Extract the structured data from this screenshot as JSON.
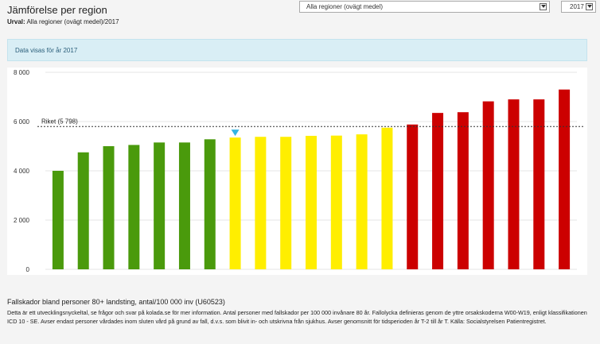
{
  "header": {
    "title": "Jämförelse per region",
    "urval_label": "Urval:",
    "urval_value": "Alla regioner (ovägt medel)/2017"
  },
  "controls": {
    "region_select": "Alla regioner (ovägt medel)",
    "year_select": "2017"
  },
  "info_banner": "Data visas för år 2017",
  "chart_data": {
    "type": "bar",
    "categories": [],
    "values": [
      4000,
      4750,
      5000,
      5050,
      5150,
      5150,
      5280,
      5350,
      5380,
      5380,
      5420,
      5430,
      5480,
      5750,
      5880,
      6350,
      6380,
      6820,
      6900,
      6900,
      7300
    ],
    "bar_colors": [
      "#4a9a0c",
      "#4a9a0c",
      "#4a9a0c",
      "#4a9a0c",
      "#4a9a0c",
      "#4a9a0c",
      "#4a9a0c",
      "#ffee00",
      "#ffee00",
      "#ffee00",
      "#ffee00",
      "#ffee00",
      "#ffee00",
      "#ffee00",
      "#cc0000",
      "#cc0000",
      "#cc0000",
      "#cc0000",
      "#cc0000",
      "#cc0000",
      "#cc0000"
    ],
    "highlight_index": 7,
    "highlight_color": "#33b5e5",
    "y_ticks": [
      0,
      2000,
      4000,
      6000,
      8000
    ],
    "y_tick_labels": [
      "0",
      "2 000",
      "4 000",
      "6 000",
      "8 000"
    ],
    "ylim": [
      0,
      8000
    ],
    "grid": true,
    "reference_line": {
      "label": "Riket (5 798)",
      "value": 5798
    }
  },
  "footer": {
    "title": "Fallskador bland personer 80+ landsting, antal/100 000 inv (U60523)",
    "description": "Detta är ett utvecklingsnyckeltal, se frågor och svar på kolada.se för mer information. Antal personer med fallskador per 100 000 invånare 80 år. Fallolycka definieras genom de yttre orsakskoderna W00-W19, enligt klassifikationen ICD 10 - SE. Avser endast personer vårdades inom sluten vård på grund av fall, d.v.s. som blivit in- och utskrivna från sjukhus. Avser genomsnitt för tidsperioden år T-2 till år T. Källa: Socialstyrelsen Patientregistret."
  }
}
